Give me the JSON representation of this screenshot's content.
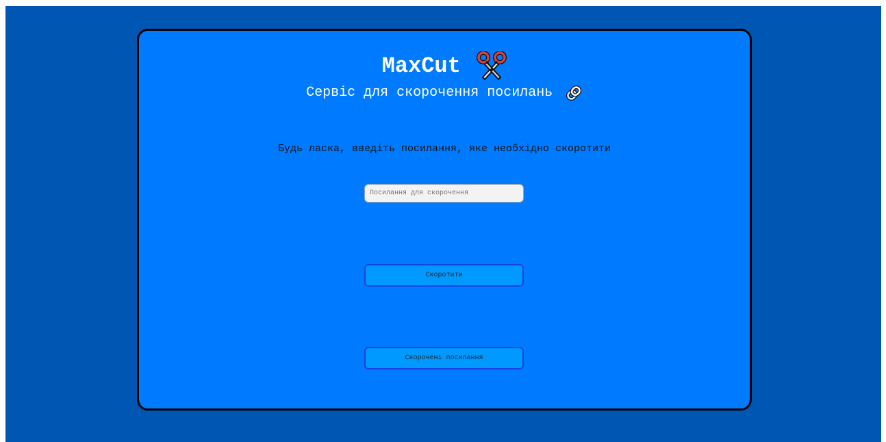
{
  "header": {
    "title": "MaxCut",
    "title_icon": "scissors-icon",
    "subtitle": "Сервіс для скорочення посилань",
    "subtitle_icon": "paperclip-icon"
  },
  "form": {
    "instruction": "Будь ласка, введіть посилання, яке необхідно скоротити",
    "url_input": {
      "value": "",
      "placeholder": "Посилання для скорочення"
    },
    "shorten_button_label": "Скоротити",
    "shortened_links_button_label": "Скорочені посилання"
  },
  "colors": {
    "page_background": "#0056b3",
    "card_background": "#007bff",
    "card_border": "#000000",
    "button_background": "#0099ff",
    "button_border": "#1a44e0",
    "input_background": "#f3f3f3"
  }
}
